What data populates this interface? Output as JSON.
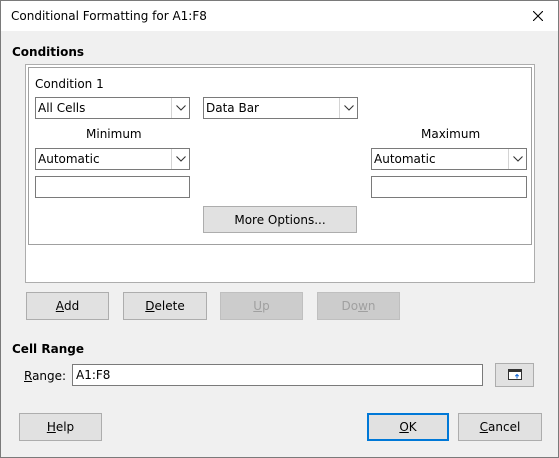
{
  "window": {
    "title": "Conditional Formatting for A1:F8"
  },
  "conditions": {
    "heading": "Conditions",
    "condition_label": "Condition 1",
    "apply_to": {
      "selected": "All Cells"
    },
    "format_type": {
      "selected": "Data Bar"
    },
    "minimum": {
      "label": "Minimum",
      "selected": "Automatic",
      "value": ""
    },
    "maximum": {
      "label": "Maximum",
      "selected": "Automatic",
      "value": ""
    },
    "more_options_label": "More Options..."
  },
  "condition_buttons": {
    "add": {
      "pre": "",
      "key": "A",
      "post": "dd"
    },
    "delete": {
      "pre": "",
      "key": "D",
      "post": "elete"
    },
    "up": {
      "pre": "",
      "key": "U",
      "post": "p"
    },
    "down": {
      "pre": "Do",
      "key": "w",
      "post": "n"
    }
  },
  "cell_range": {
    "heading": "Cell Range",
    "range_label": {
      "pre": "",
      "key": "R",
      "post": "ange:"
    },
    "range_value": "A1:F8"
  },
  "footer": {
    "help": {
      "pre": "",
      "key": "H",
      "post": "elp"
    },
    "ok": {
      "pre": "",
      "key": "O",
      "post": "K"
    },
    "cancel": {
      "pre": "",
      "key": "C",
      "post": "ancel"
    }
  },
  "colors": {
    "default_button_border": "#0078d7",
    "disabled_text": "#a0a0a0"
  },
  "icons": {
    "close": "close-icon",
    "dropdown": "chevron-down-icon",
    "shrink": "shrink-dialog-icon"
  }
}
